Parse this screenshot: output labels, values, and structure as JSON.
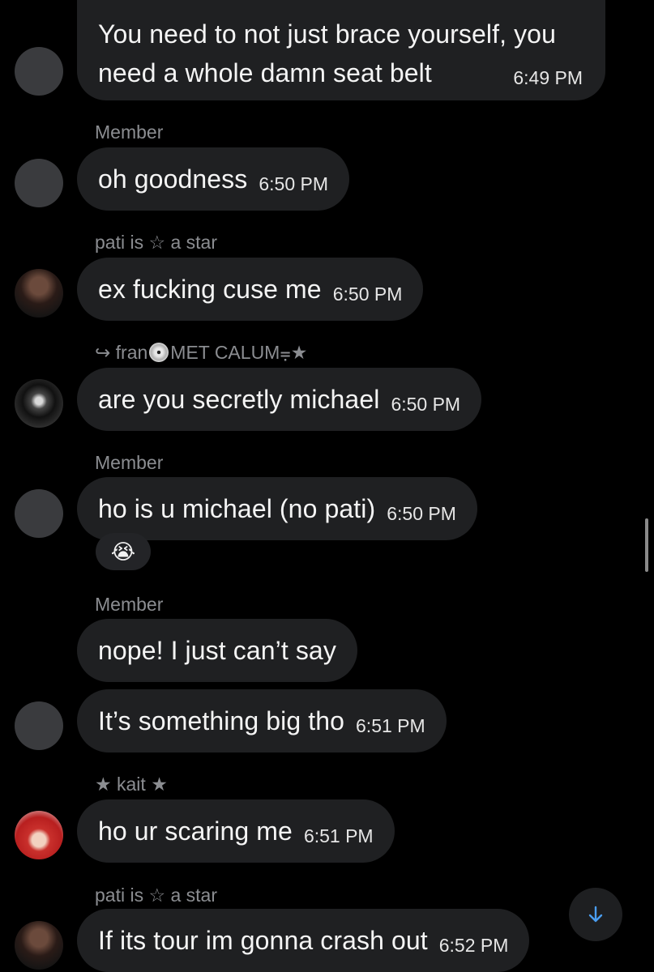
{
  "messages": [
    {
      "text": "You need to not just brace yourself, you need a whole damn seat belt",
      "time": "6:49 PM"
    },
    {
      "sender": "Member",
      "text": "oh goodness",
      "time": "6:50 PM"
    },
    {
      "sender": "pati is ☆ a star",
      "text": "ex fucking cuse me",
      "time": "6:50 PM"
    },
    {
      "sender_prefix": "↪ fran",
      "sender_suffix": "MET CALUM⩦★",
      "text": "are you secretly michael",
      "time": "6:50 PM"
    },
    {
      "sender": "Member",
      "text": "ho is u michael (no pati)",
      "time": "6:50 PM",
      "reaction": "😭"
    },
    {
      "sender": "Member",
      "text": "nope! I just can’t say"
    },
    {
      "text": "It’s something big tho",
      "time": "6:51 PM"
    },
    {
      "sender": "★ kait ★",
      "text": "ho ur scaring me",
      "time": "6:51 PM"
    },
    {
      "sender": "pati is ☆ a star",
      "text": "If its tour im gonna crash out",
      "time": "6:52 PM"
    }
  ],
  "controls": {
    "scroll_down_icon": "arrow-down-icon"
  },
  "colors": {
    "background": "#000000",
    "bubble": "#1f2022",
    "sender": "#8b8d91",
    "accent": "#4a9df0"
  }
}
